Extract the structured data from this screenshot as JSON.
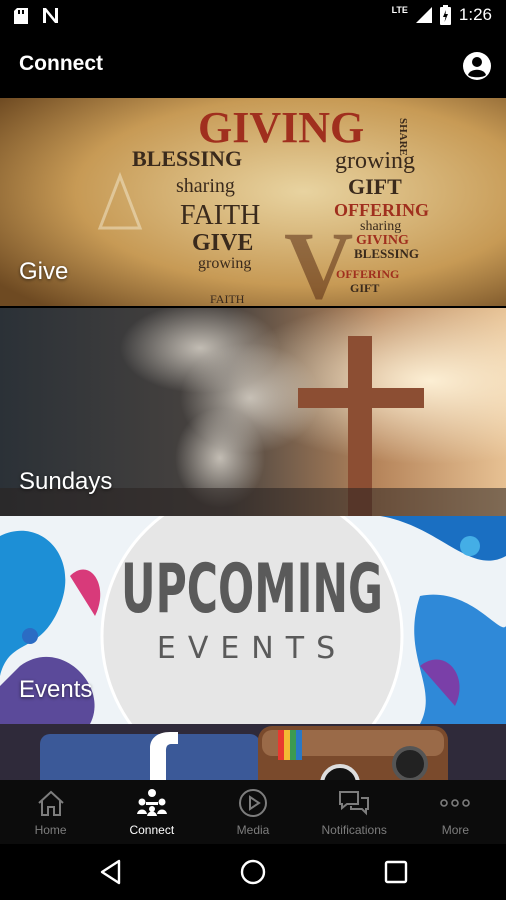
{
  "status_bar": {
    "network": "LTE",
    "time": "1:26"
  },
  "app_bar": {
    "title": "Connect"
  },
  "tiles": [
    {
      "label": "Give",
      "art_words": [
        "GIVING",
        "BLESSING",
        "growing",
        "GIFT",
        "sharing",
        "FAITH",
        "OFFERING",
        "GIVE",
        "growing",
        "GIVING",
        "sharing",
        "BLESSING",
        "OFFERING",
        "SHARE",
        "GIFT",
        "FAITH"
      ]
    },
    {
      "label": "Sundays"
    },
    {
      "label": "Events",
      "art_title": "UPCOMING",
      "art_subtitle": "EVENTS"
    },
    {
      "label": ""
    }
  ],
  "bottom_nav": {
    "items": [
      {
        "label": "Home",
        "icon": "home-icon",
        "active": false
      },
      {
        "label": "Connect",
        "icon": "connect-icon",
        "active": true
      },
      {
        "label": "Media",
        "icon": "play-icon",
        "active": false
      },
      {
        "label": "Notifications",
        "icon": "chat-icon",
        "active": false
      },
      {
        "label": "More",
        "icon": "more-icon",
        "active": false
      }
    ]
  },
  "colors": {
    "background": "#000000",
    "inactive_nav": "#7d7d7d",
    "active_nav": "#ffffff",
    "giving_red": "#a02f1e"
  }
}
